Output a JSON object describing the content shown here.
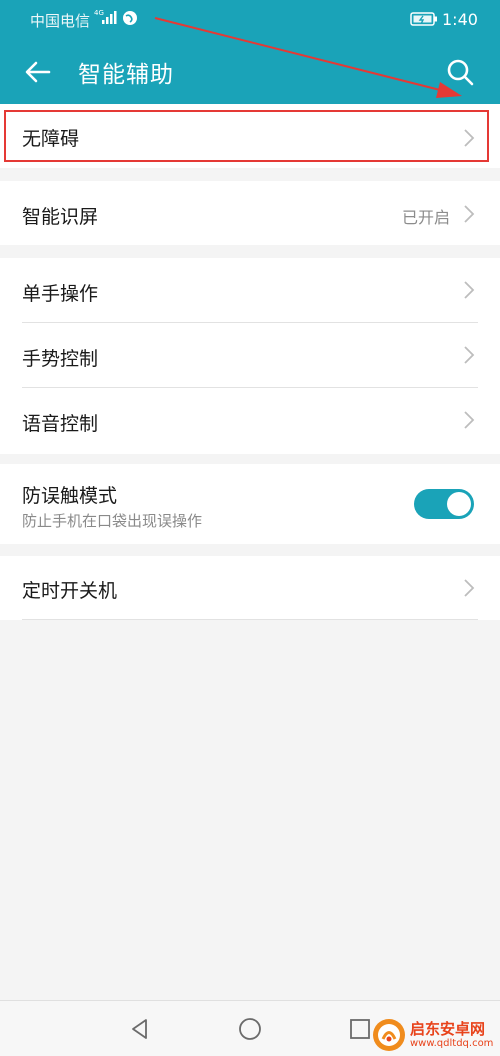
{
  "status_bar": {
    "carrier": "中国电信",
    "network_type": "4G",
    "time": "1:40"
  },
  "app_bar": {
    "title": "智能辅助"
  },
  "settings": {
    "accessibility": {
      "label": "无障碍"
    },
    "smart_screen": {
      "label": "智能识屏",
      "value": "已开启"
    },
    "one_hand": {
      "label": "单手操作"
    },
    "gesture": {
      "label": "手势控制"
    },
    "voice": {
      "label": "语音控制"
    },
    "pocket_mode": {
      "label": "防误触模式",
      "description": "防止手机在口袋出现误操作",
      "enabled": true
    },
    "scheduled_power": {
      "label": "定时开关机"
    }
  },
  "watermark": {
    "name": "启东安卓网",
    "url": "www.qdltdq.com"
  },
  "colors": {
    "accent": "#1aa3b8",
    "highlight_box": "#e53935",
    "annotation_arrow": "#e53935"
  }
}
